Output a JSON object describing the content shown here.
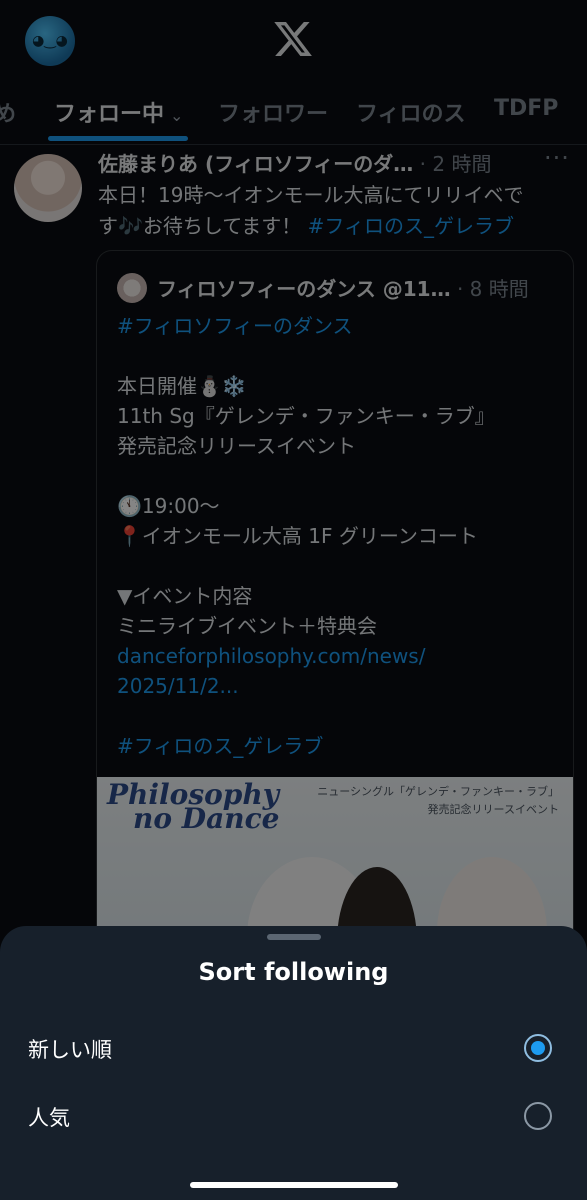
{
  "header": {
    "avatar_icon": "user-avatar",
    "logo_icon": "x-logo"
  },
  "tabs": [
    {
      "label": "め"
    },
    {
      "label": "フォロー中",
      "chevron": "⌄"
    },
    {
      "label": "フォロワー"
    },
    {
      "label": "フィロのス"
    },
    {
      "label": "TDFP"
    }
  ],
  "tweet": {
    "author": "佐藤まりあ (フィロソフィーのダ…",
    "time": "· 2 時間",
    "more": "···",
    "text_1": "本日！19時〜イオンモール大高にてリリイベで",
    "text_2": "す",
    "text_emoji": "🎶",
    "text_3": "お待ちしてます！",
    "hashtag": "#フィロのス_ゲレラブ"
  },
  "quote": {
    "author": "フィロソフィーのダンス @11…",
    "time": "· 8 時間",
    "lines": {
      "l1": "#フィロソフィーのダンス",
      "l3": "本日開催⛄❄️",
      "l4": "11th Sg『ゲレンデ・ファンキー・ラブ』",
      "l5": "発売記念リリースイベント",
      "l7": "🕚19:00〜",
      "l8": "📍イオンモール大高 1F グリーンコート",
      "l10": "▼イベント内容",
      "l11": "ミニライブイベント＋特典会",
      "l12": "danceforphilosophy.com/news/",
      "l13": "2025/11/2...",
      "l15": "#フィロのス_ゲレラブ"
    },
    "image": {
      "logo_1": "Philosophy",
      "logo_2": "no Dance",
      "caption_1": "ニューシングル「ゲレンデ・ファンキー・ラブ」",
      "caption_2": "発売記念リリースイベント"
    }
  },
  "sheet": {
    "title": "Sort following",
    "options": [
      {
        "label": "新しい順",
        "selected": true
      },
      {
        "label": "人気",
        "selected": false
      }
    ]
  },
  "colors": {
    "accent": "#1d9bf0",
    "sheet_bg": "#17202b"
  }
}
